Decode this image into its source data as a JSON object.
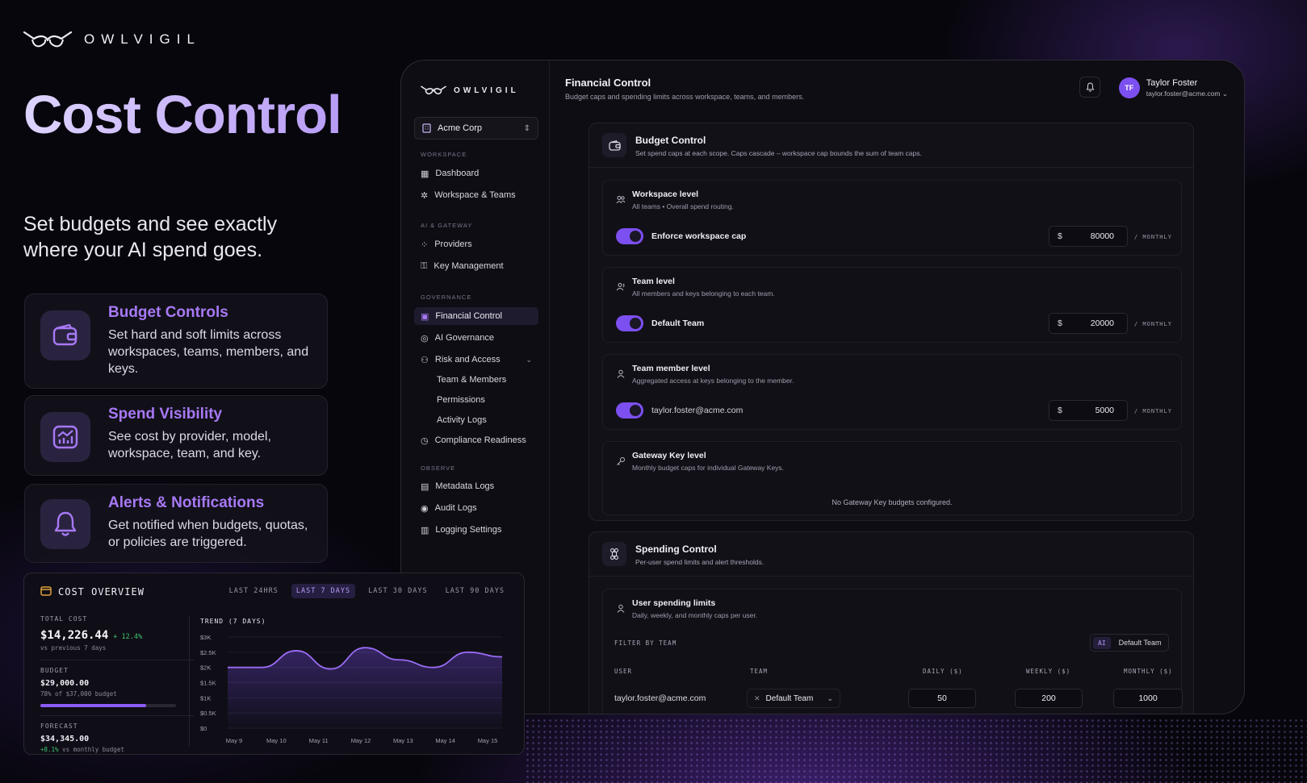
{
  "brand": {
    "name": "OWLVIGIL"
  },
  "hero": {
    "title": "Cost Control",
    "subtitle": "Set budgets and see exactly where your AI spend goes."
  },
  "features": [
    {
      "title": "Budget Controls",
      "desc": "Set hard and soft limits across workspaces, teams, members, and keys.",
      "icon": "wallet-icon"
    },
    {
      "title": "Spend Visibility",
      "desc": "See cost by provider, model, workspace, team, and key.",
      "icon": "chart-icon"
    },
    {
      "title": "Alerts & Notifications",
      "desc": "Get notified when budgets, quotas, or policies are triggered.",
      "icon": "bell-icon"
    }
  ],
  "overview": {
    "title": "COST OVERVIEW",
    "ranges": [
      "LAST 24HRS",
      "LAST 7 DAYS",
      "LAST 30 DAYS",
      "LAST 90 DAYS"
    ],
    "active_range": "LAST 7 DAYS",
    "total_label": "TOTAL COST",
    "total_value": "$14,226.44",
    "total_change": "+ 12.4%",
    "total_note": "vs previous 7 days",
    "budget_label": "BUDGET",
    "budget_value": "$29,000.00",
    "budget_note": "78% of $37,000 budget",
    "budget_progress": 0.78,
    "forecast_label": "FORECAST",
    "forecast_value": "$34,345.00",
    "forecast_change": "+8.1%",
    "forecast_note": "vs monthly budget",
    "accent": "#8b5cf6"
  },
  "chart_data": {
    "type": "area",
    "title": "TREND (7 DAYS)",
    "x": [
      "May 9",
      "May 10",
      "May 11",
      "May 12",
      "May 13",
      "May 14",
      "May 15"
    ],
    "y_ticks": [
      "$3K",
      "$2.5K",
      "$2K",
      "$1.5K",
      "$1K",
      "$0.5K",
      "$0"
    ],
    "ylim": [
      0,
      3000
    ],
    "series": [
      {
        "values": [
          2000,
          2000,
          2550,
          1950,
          2650,
          2250,
          2000,
          2500,
          2350
        ]
      }
    ],
    "xlabel": "",
    "ylabel": "",
    "grid": true
  },
  "sidebar": {
    "org": "Acme Corp",
    "sections": {
      "workspace": "WORKSPACE",
      "ai_gateway": "AI & GATEWAY",
      "governance": "GOVERNANCE",
      "observe": "OBSERVE"
    },
    "items": {
      "dashboard": "Dashboard",
      "workspace_teams": "Workspace & Teams",
      "providers": "Providers",
      "key_management": "Key Management",
      "financial_control": "Financial Control",
      "ai_governance": "AI Governance",
      "risk_access": "Risk and Access",
      "team_members": "Team & Members",
      "permissions": "Permissions",
      "activity_logs": "Activity Logs",
      "compliance": "Compliance Readiness",
      "metadata_logs": "Metadata Logs",
      "audit_logs": "Audit Logs",
      "logging_settings": "Logging Settings"
    }
  },
  "header": {
    "title": "Financial Control",
    "subtitle": "Budget caps and spending limits across workspace, teams, and members.",
    "user_initials": "TF",
    "user_name": "Taylor Foster",
    "user_email": "taylor.foster@acme.com"
  },
  "budget": {
    "title": "Budget Control",
    "subtitle": "Set spend caps at each scope. Caps cascade – workspace cap bounds the sum of team caps.",
    "levels": [
      {
        "title": "Workspace level",
        "sub": "All teams • Overall spend routing.",
        "toggle": "Enforce workspace cap",
        "currency": "$",
        "amount": "80000",
        "period": "/ MONTHLY"
      },
      {
        "title": "Team level",
        "sub": "All members and keys belonging to each team.",
        "toggle": "Default Team",
        "currency": "$",
        "amount": "20000",
        "period": "/ MONTHLY"
      },
      {
        "title": "Team member level",
        "sub": "Aggregated access at keys belonging to the member.",
        "toggle": "taylor.foster@acme.com",
        "currency": "$",
        "amount": "5000",
        "period": "/ MONTHLY"
      }
    ],
    "gateway": {
      "title": "Gateway Key level",
      "sub": "Monthly budget caps for individual Gateway Keys.",
      "empty": "No Gateway Key budgets configured."
    }
  },
  "spending": {
    "title": "Spending Control",
    "subtitle": "Per-user spend limits and alert thresholds.",
    "user_title": "User spending limits",
    "user_sub": "Daily, weekly, and monthly caps per user.",
    "filter_label": "FILTER BY TEAM",
    "filter_tag": "AI",
    "filter_value": "Default Team",
    "columns": [
      "USER",
      "TEAM",
      "DAILY ($)",
      "WEEKLY ($)",
      "MONTHLY ($)"
    ],
    "row": {
      "user": "taylor.foster@acme.com",
      "team": "Default Team",
      "daily": "50",
      "weekly": "200",
      "monthly": "1000"
    }
  }
}
